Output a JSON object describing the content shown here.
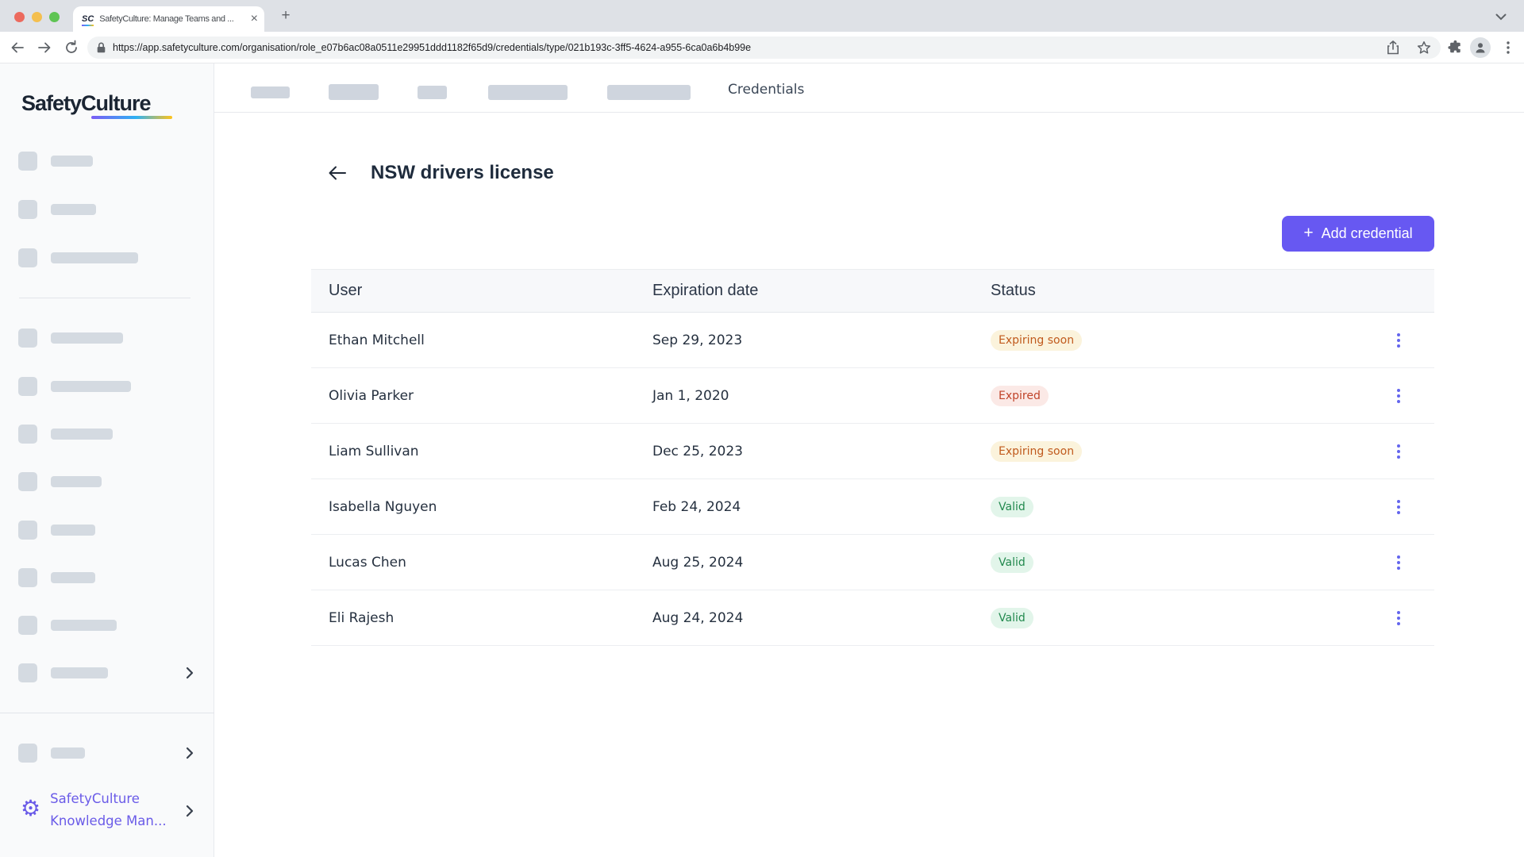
{
  "browser": {
    "tab_title": "SafetyCulture: Manage Teams and ...",
    "favicon_text": "SC",
    "url": "https://app.safetyculture.com/organisation/role_e07b6ac08a0511e29951ddd1182f65d9/credentials/type/021b193c-3ff5-4624-a955-6ca0a6b4b99e",
    "new_tab_label": "+",
    "close_tab_label": "×"
  },
  "sidebar": {
    "logo_text": "SafetyCulture",
    "knowledge_link": {
      "line1": "SafetyCulture",
      "line2": "Knowledge Man...",
      "gear_glyph": "⚙"
    }
  },
  "nav": {
    "active_label": "Credentials"
  },
  "page": {
    "title": "NSW drivers license",
    "add_button_label": "Add credential",
    "add_button_plus": "+"
  },
  "table": {
    "columns": {
      "user": "User",
      "expiration": "Expiration date",
      "status": "Status"
    },
    "rows": [
      {
        "user": "Ethan Mitchell",
        "expiration": "Sep 29, 2023",
        "status": "Expiring soon",
        "status_type": "warning"
      },
      {
        "user": "Olivia Parker",
        "expiration": "Jan 1, 2020",
        "status": "Expired",
        "status_type": "expired"
      },
      {
        "user": "Liam Sullivan",
        "expiration": "Dec 25, 2023",
        "status": "Expiring soon",
        "status_type": "warning"
      },
      {
        "user": "Isabella Nguyen",
        "expiration": "Feb 24, 2024",
        "status": "Valid",
        "status_type": "valid"
      },
      {
        "user": "Lucas Chen",
        "expiration": "Aug 25, 2024",
        "status": "Valid",
        "status_type": "valid"
      },
      {
        "user": "Eli Rajesh",
        "expiration": "Aug 24, 2024",
        "status": "Valid",
        "status_type": "valid"
      }
    ]
  },
  "colors": {
    "brand_purple": "#6758F2",
    "badge_warning_text": "#C05A1D",
    "badge_expired_text": "#C0442A",
    "badge_valid_text": "#22894E"
  }
}
